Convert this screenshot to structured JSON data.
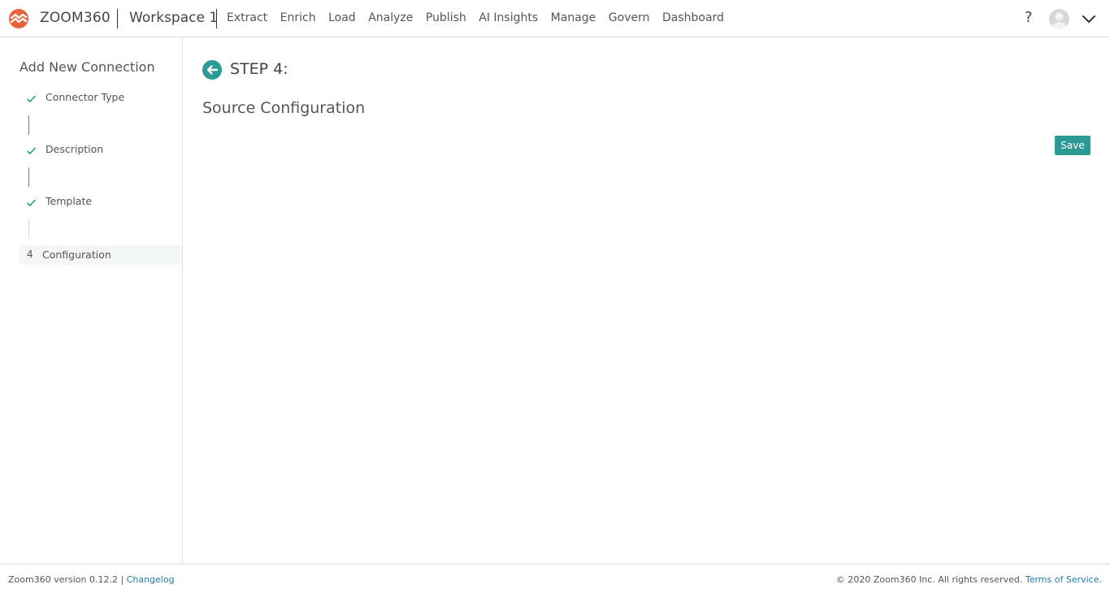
{
  "header": {
    "brand": "ZOOM360",
    "workspace": "Workspace 1",
    "nav": [
      "Extract",
      "Enrich",
      "Load",
      "Analyze",
      "Publish",
      "AI Insights",
      "Manage",
      "Govern",
      "Dashboard"
    ],
    "help": "?"
  },
  "sidebar": {
    "title": "Add New Connection",
    "steps": [
      {
        "label": "Connector Type",
        "status": "done"
      },
      {
        "label": "Description",
        "status": "done"
      },
      {
        "label": "Template",
        "status": "done"
      },
      {
        "number": "4",
        "label": "Configuration",
        "status": "active"
      }
    ]
  },
  "main": {
    "step_heading": "STEP 4:",
    "section_title": "Source Configuration",
    "save_label": "Save"
  },
  "footer": {
    "version_text": "Zoom360 version 0.12.2 |",
    "changelog": "Changelog",
    "copyright": "© 2020 Zoom360 Inc. All rights reserved.",
    "terms": "Terms of Service."
  },
  "colors": {
    "accent": "#2b9a94",
    "link": "#1f7aa8",
    "logo": "#e8633a"
  }
}
